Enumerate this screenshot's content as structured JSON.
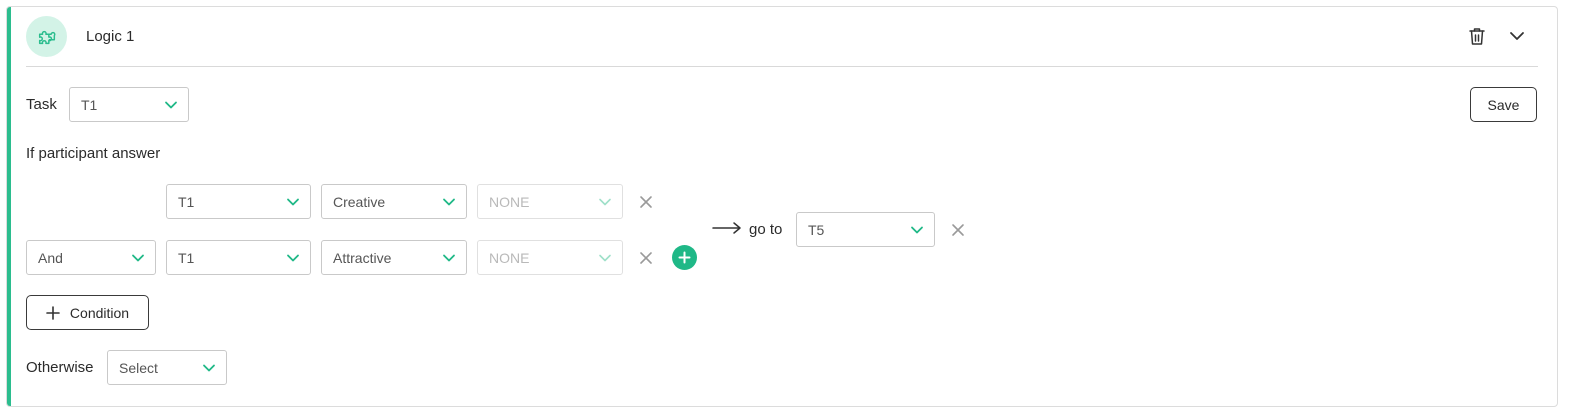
{
  "logic": {
    "title": "Logic 1",
    "header_icon": "puzzle-icon",
    "actions": {
      "delete_icon": "trash-icon",
      "collapse_icon": "chevron-down-icon"
    }
  },
  "task": {
    "label": "Task",
    "value": "T1"
  },
  "save_button": {
    "label": "Save"
  },
  "condition_heading": "If participant answer",
  "conditions": [
    {
      "connector": "",
      "task": "T1",
      "answer": "Creative",
      "modifier": "NONE"
    },
    {
      "connector": "And",
      "task": "T1",
      "answer": "Attractive",
      "modifier": "NONE"
    }
  ],
  "goto": {
    "label": "go to",
    "value": "T5"
  },
  "add_condition_button": {
    "label": "Condition",
    "icon": "plus-icon"
  },
  "otherwise": {
    "label": "Otherwise",
    "value": "Select"
  },
  "colors": {
    "accent": "#2bbd8e",
    "accent_light": "#d3f3e7",
    "add_button": "#1fb887"
  }
}
